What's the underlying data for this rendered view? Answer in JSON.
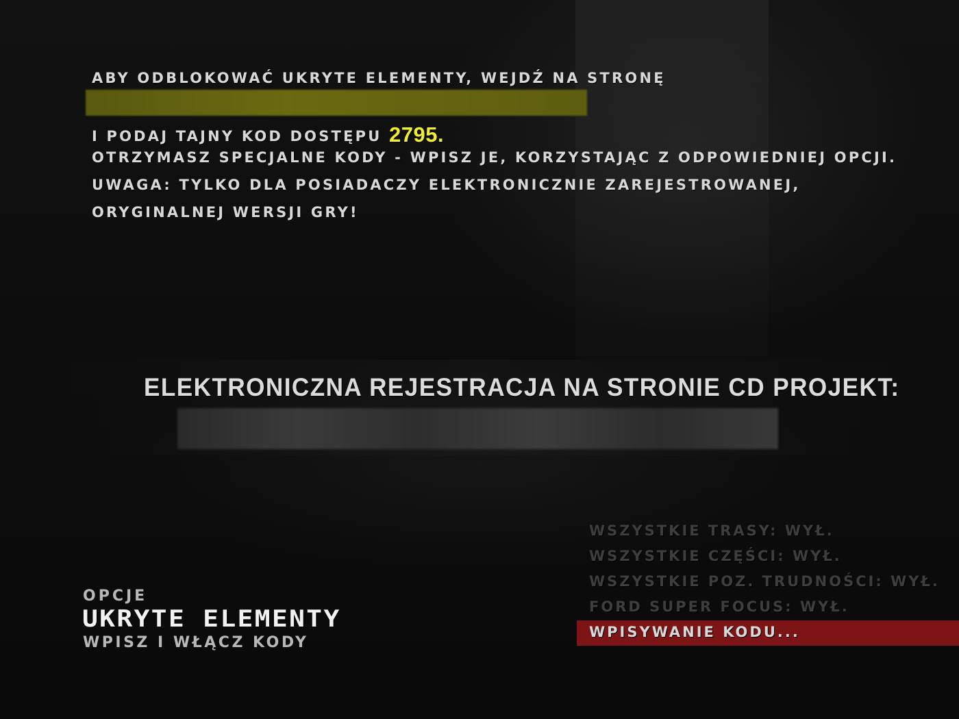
{
  "info": {
    "line1": "ABY ODBLOKOWAĆ UKRYTE ELEMENTY, WEJDŹ NA STRONĘ",
    "line3_prefix": "I PODAJ TAJNY KOD DOSTĘPU ",
    "access_code": "2795.",
    "line4": "OTRZYMASZ SPECJALNE KODY - WPISZ JE, KORZYSTAJĄC Z ODPOWIEDNIEJ OPCJI.",
    "line5": "UWAGA: TYLKO DLA POSIADACZY ELEKTRONICZNIE ZAREJESTROWANEJ,",
    "line6": "ORYGINALNEJ WERSJI GRY!"
  },
  "registration": {
    "heading": "ELEKTRONICZNA REJESTRACJA NA STRONIE CD PROJEKT:"
  },
  "menu": {
    "items": [
      {
        "label": "WSZYSTKIE TRASY: WYŁ."
      },
      {
        "label": "WSZYSTKIE CZĘŚCI: WYŁ."
      },
      {
        "label": "WSZYSTKIE POZ. TRUDNOŚCI: WYŁ."
      },
      {
        "label": "FORD SUPER FOCUS: WYŁ."
      },
      {
        "label": "WPISYWANIE KODU..."
      }
    ],
    "selected_index": 4
  },
  "section": {
    "category": "OPCJE",
    "title": "UKRYTE ELEMENTY",
    "subtitle": "WPISZ I WŁĄCZ KODY"
  },
  "colors": {
    "highlight": "#7d1416",
    "code_yellow": "#f0ee2e",
    "redacted_url": "#5e5e10"
  }
}
